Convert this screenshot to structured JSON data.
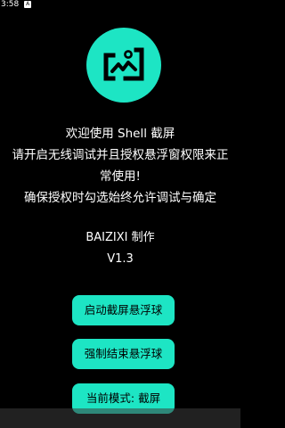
{
  "status_bar": {
    "time": "3:58",
    "notification_icon": "A"
  },
  "app": {
    "logo_icon": "image-photo-icon",
    "intro_lines": [
      "欢迎使用 Shell 截屏",
      "请开启无线调试并且授权悬浮窗权限来正",
      "常使用!",
      "确保授权时勾选始终允许调试与确定"
    ],
    "author": "BAIZIXI 制作",
    "version": "V1.3"
  },
  "buttons": {
    "start_label": "启动截屏悬浮球",
    "stop_label": "强制结束悬浮球",
    "mode_label": "当前模式: 截屏"
  },
  "colors": {
    "accent": "#1de5c4",
    "background": "#000000",
    "text": "#ffffff"
  }
}
